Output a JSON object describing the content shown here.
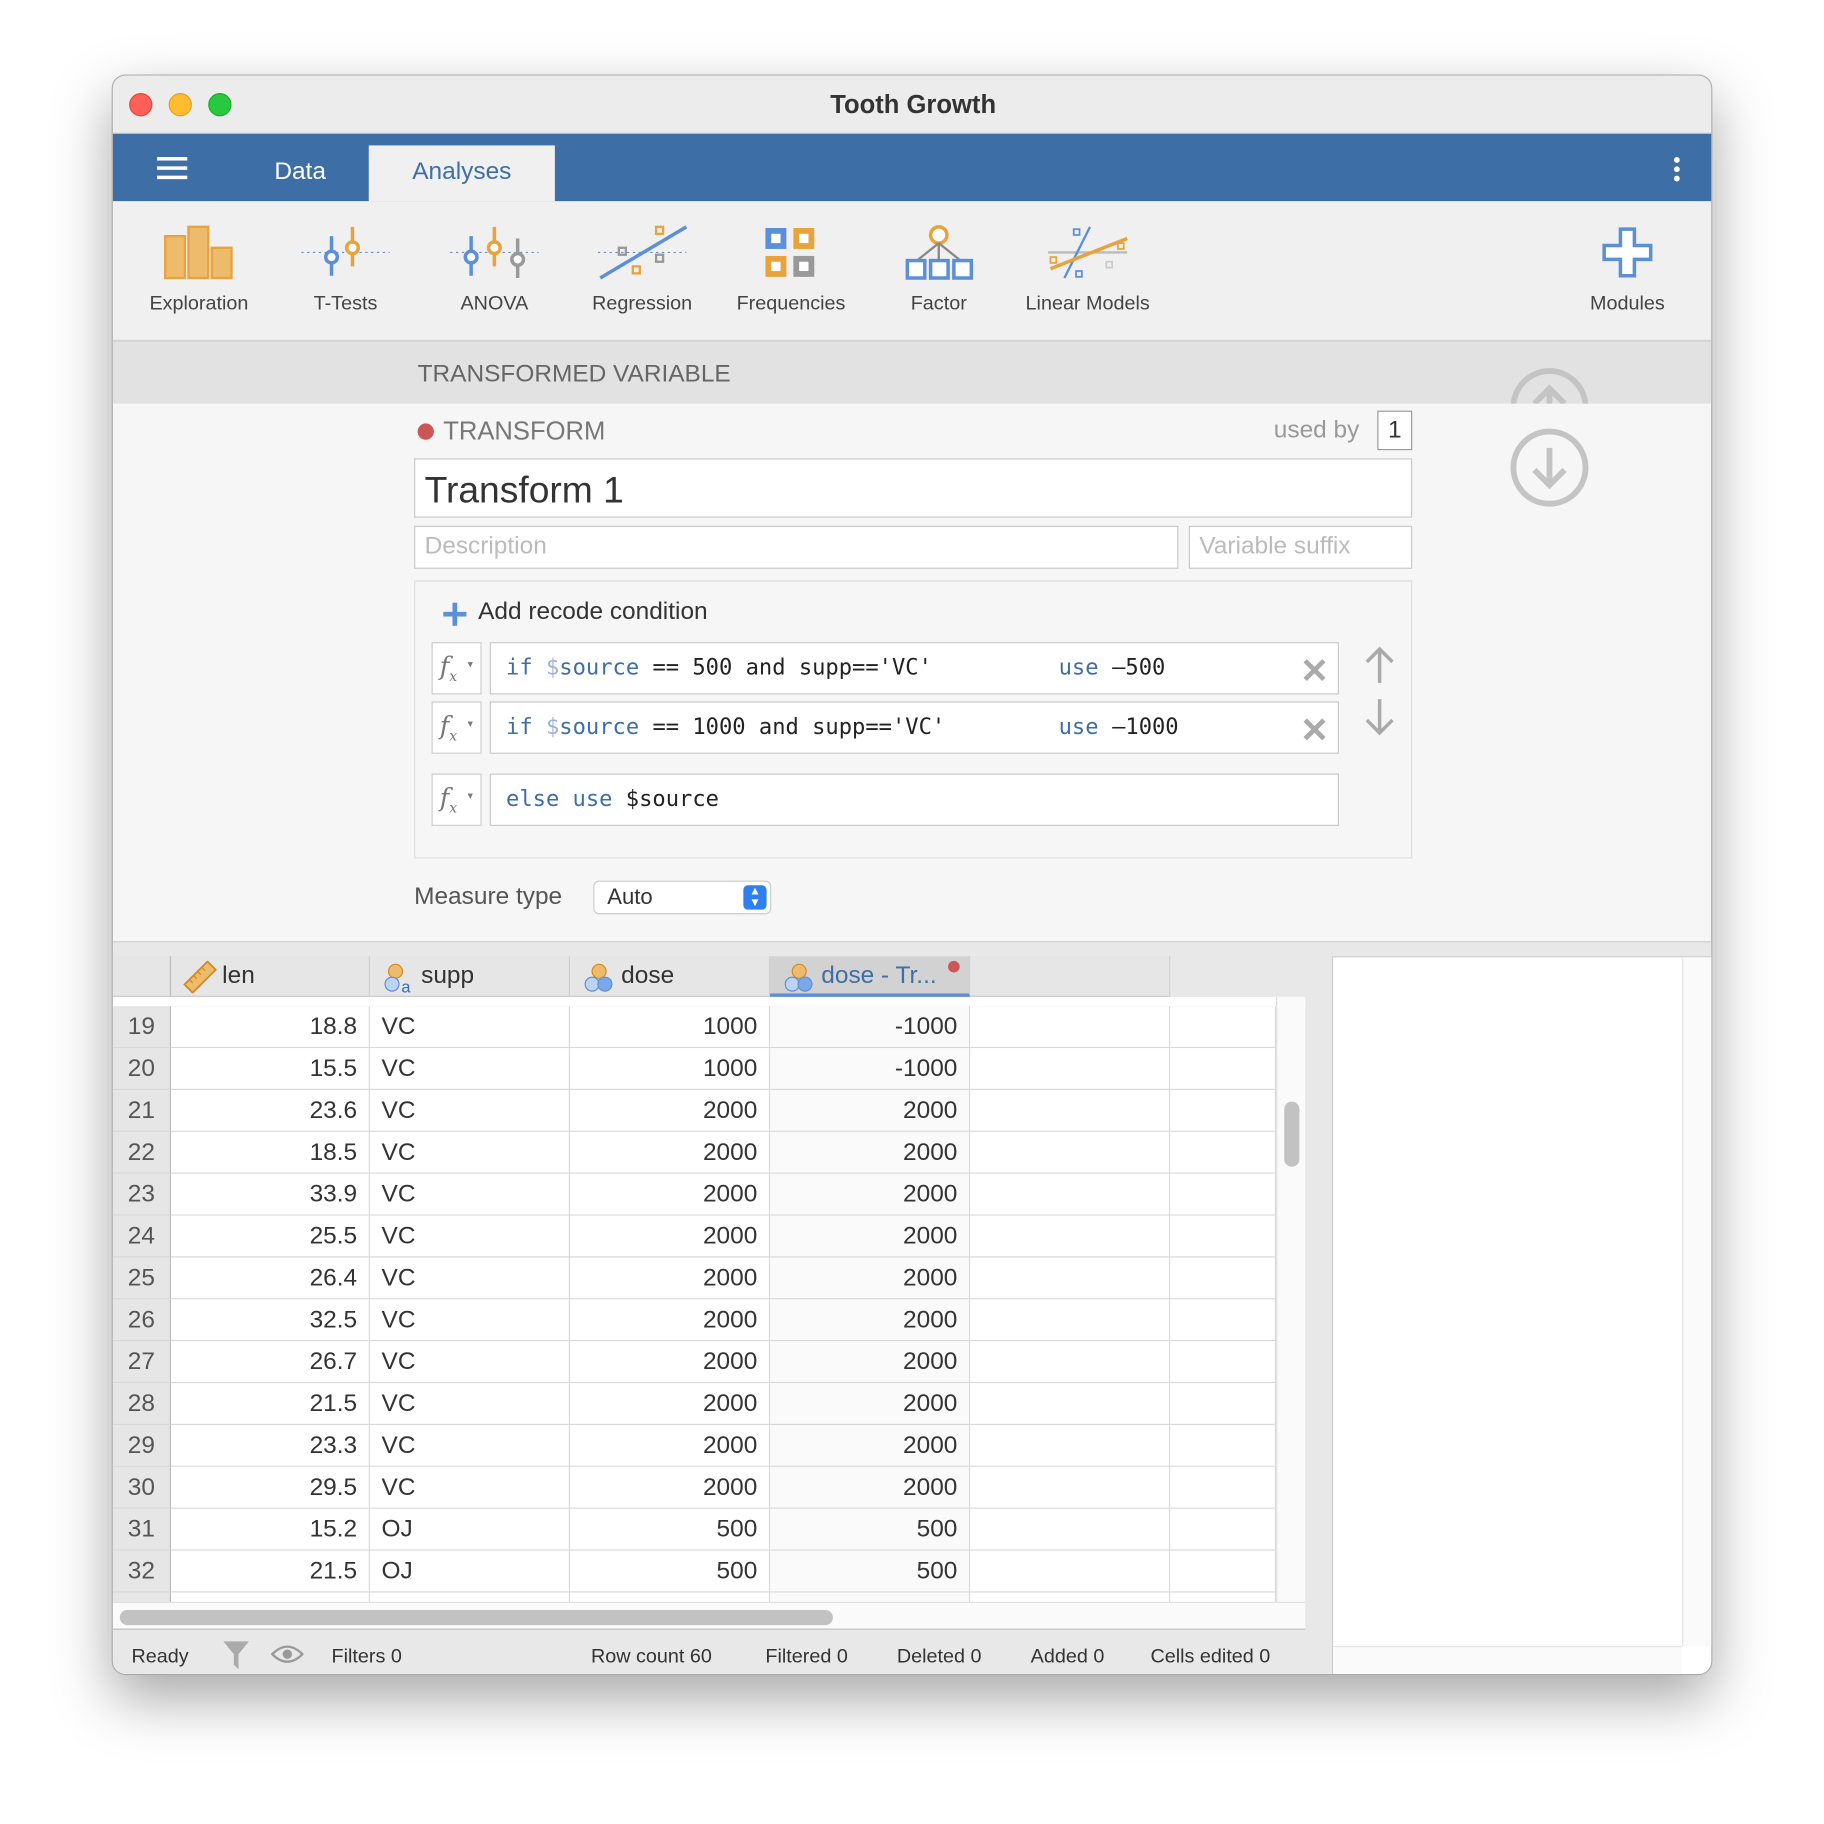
{
  "window": {
    "title": "Tooth Growth"
  },
  "tabs": [
    {
      "label": "Data"
    },
    {
      "label": "Analyses",
      "active": true
    }
  ],
  "ribbon": [
    {
      "label": "Exploration",
      "icon": "exploration-icon"
    },
    {
      "label": "T-Tests",
      "icon": "ttests-icon"
    },
    {
      "label": "ANOVA",
      "icon": "anova-icon"
    },
    {
      "label": "Regression",
      "icon": "regression-icon"
    },
    {
      "label": "Frequencies",
      "icon": "frequencies-icon"
    },
    {
      "label": "Factor",
      "icon": "factor-icon"
    },
    {
      "label": "Linear Models",
      "icon": "linear-models-icon"
    },
    {
      "label": "Modules",
      "icon": "plus-icon"
    }
  ],
  "section_title": "TRANSFORMED VARIABLE",
  "transform": {
    "label": "TRANSFORM",
    "used_by_label": "used by",
    "used_by_count": "1",
    "name": "Transform 1",
    "description_placeholder": "Description",
    "suffix_placeholder": "Variable suffix",
    "add_condition": "Add recode condition",
    "conditions": [
      {
        "if": "if",
        "src": "$",
        "srcname": "source",
        "expr": " == 500 and supp=='VC'",
        "use": "use",
        "value": "–500"
      },
      {
        "if": "if",
        "src": "$",
        "srcname": "source",
        "expr": " == 1000 and supp=='VC'",
        "use": "use",
        "value": "–1000"
      }
    ],
    "else": {
      "kw": "else use",
      "value": "$source"
    },
    "measure_type_label": "Measure type",
    "measure_type_value": "Auto"
  },
  "grid": {
    "columns": [
      "len",
      "supp",
      "dose",
      "dose - Tr..."
    ],
    "rows": [
      [
        "19",
        "18.8",
        "VC",
        "1000",
        "-1000"
      ],
      [
        "20",
        "15.5",
        "VC",
        "1000",
        "-1000"
      ],
      [
        "21",
        "23.6",
        "VC",
        "2000",
        "2000"
      ],
      [
        "22",
        "18.5",
        "VC",
        "2000",
        "2000"
      ],
      [
        "23",
        "33.9",
        "VC",
        "2000",
        "2000"
      ],
      [
        "24",
        "25.5",
        "VC",
        "2000",
        "2000"
      ],
      [
        "25",
        "26.4",
        "VC",
        "2000",
        "2000"
      ],
      [
        "26",
        "32.5",
        "VC",
        "2000",
        "2000"
      ],
      [
        "27",
        "26.7",
        "VC",
        "2000",
        "2000"
      ],
      [
        "28",
        "21.5",
        "VC",
        "2000",
        "2000"
      ],
      [
        "29",
        "23.3",
        "VC",
        "2000",
        "2000"
      ],
      [
        "30",
        "29.5",
        "VC",
        "2000",
        "2000"
      ],
      [
        "31",
        "15.2",
        "OJ",
        "500",
        "500"
      ],
      [
        "32",
        "21.5",
        "OJ",
        "500",
        "500"
      ]
    ]
  },
  "status": {
    "ready": "Ready",
    "filters": "Filters 0",
    "row_count": "Row count 60",
    "filtered": "Filtered 0",
    "deleted": "Deleted 0",
    "added": "Added 0",
    "cells_edited": "Cells edited 0"
  },
  "colors": {
    "accent": "#3e6ea6",
    "orange": "#e8a33c",
    "red_dot": "#cc5555"
  }
}
